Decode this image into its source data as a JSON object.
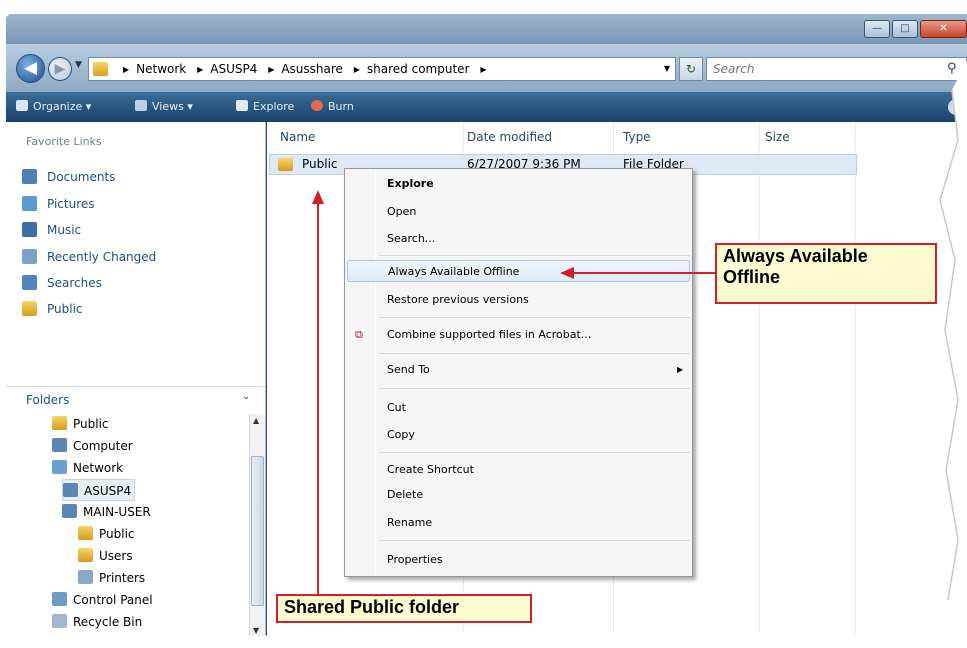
{
  "window": {
    "minimize_glyph": "—",
    "maximize_glyph": "□",
    "close_glyph": "✕"
  },
  "address": {
    "back_glyph": "◀",
    "forward_glyph": "▶",
    "history_glyph": "▼",
    "crumbs": [
      "Network",
      "ASUSP4",
      "Asusshare",
      "shared computer"
    ],
    "separator": "▶",
    "dropdown_glyph": "▼",
    "refresh_glyph": "↻",
    "search_placeholder": "Search",
    "search_glyph": "⚲"
  },
  "toolbar": {
    "organize": "Organize ▾",
    "views": "Views ▾",
    "explore": "Explore",
    "burn": "Burn",
    "help_glyph": "?"
  },
  "nav": {
    "favorites_title": "Favorite Links",
    "favorites": [
      {
        "label": "Documents",
        "icon": "documents-icon"
      },
      {
        "label": "Pictures",
        "icon": "pictures-icon"
      },
      {
        "label": "Music",
        "icon": "music-icon"
      },
      {
        "label": "Recently Changed",
        "icon": "recently-changed-icon"
      },
      {
        "label": "Searches",
        "icon": "searches-icon"
      },
      {
        "label": "Public",
        "icon": "folder-icon"
      }
    ],
    "folders_title": "Folders",
    "folders_chevron": "⌄",
    "tree": [
      {
        "label": "Public",
        "icon": "folder-icon"
      },
      {
        "label": "Computer",
        "icon": "computer-icon"
      },
      {
        "label": "Network",
        "icon": "network-icon"
      },
      {
        "label": "ASUSP4",
        "icon": "computer-icon"
      },
      {
        "label": "MAIN-USER",
        "icon": "computer-icon"
      },
      {
        "label": "Public",
        "icon": "shared-folder-icon"
      },
      {
        "label": "Users",
        "icon": "shared-folder-icon"
      },
      {
        "label": "Printers",
        "icon": "printer-icon"
      },
      {
        "label": "Control Panel",
        "icon": "control-panel-icon"
      },
      {
        "label": "Recycle Bin",
        "icon": "recycle-bin-icon"
      }
    ]
  },
  "list": {
    "columns": [
      "Name",
      "Date modified",
      "Type",
      "Size"
    ],
    "rows": [
      {
        "name": "Public",
        "date": "6/27/2007 9:36 PM",
        "type": "File Folder",
        "size": ""
      }
    ]
  },
  "context_menu": {
    "items": [
      "Explore",
      "Open",
      "Search...",
      "Always Available Offline",
      "Restore previous versions",
      "Combine supported files in Acrobat...",
      "Send To",
      "Cut",
      "Copy",
      "Create Shortcut",
      "Delete",
      "Rename",
      "Properties"
    ],
    "submenu_arrow": "▶"
  },
  "callouts": {
    "offline_line1": "Always Available",
    "offline_line2": "Offline",
    "public": "Shared Public folder"
  },
  "colors": {
    "callout_border": "#d21f2a",
    "callout_fill": "#fffbd0",
    "toolbar": "#17426c",
    "link": "#1d4f87"
  }
}
